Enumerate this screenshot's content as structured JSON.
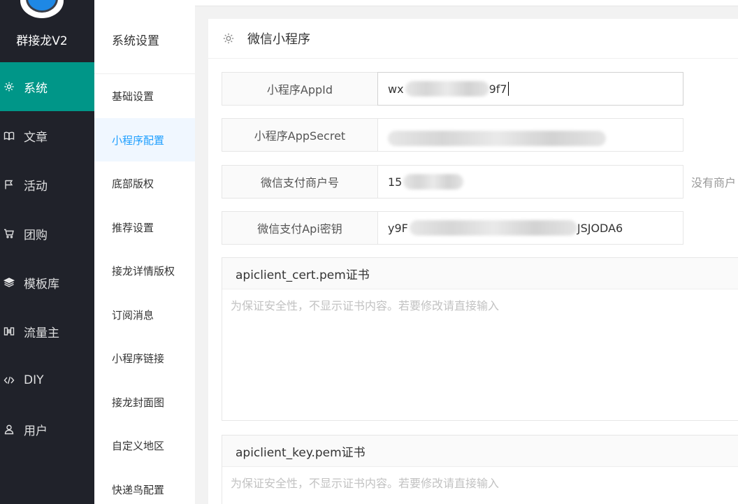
{
  "app": {
    "brand": "群接龙V2"
  },
  "sidebar": {
    "items": [
      {
        "label": "系统",
        "icon": "gear-icon",
        "active": true
      },
      {
        "label": "文章",
        "icon": "book-icon"
      },
      {
        "label": "活动",
        "icon": "flag-icon"
      },
      {
        "label": "团购",
        "icon": "cart-icon"
      },
      {
        "label": "模板库",
        "icon": "layers-icon"
      },
      {
        "label": "流量主",
        "icon": "columns-icon"
      },
      {
        "label": "DIY",
        "icon": "code-icon"
      },
      {
        "label": "用户",
        "icon": "user-icon"
      }
    ]
  },
  "submenu": {
    "title": "系统设置",
    "items": [
      {
        "label": "基础设置"
      },
      {
        "label": "小程序配置",
        "active": true
      },
      {
        "label": "底部版权"
      },
      {
        "label": "推荐设置"
      },
      {
        "label": "接龙详情版权"
      },
      {
        "label": "订阅消息"
      },
      {
        "label": "小程序链接"
      },
      {
        "label": "接龙封面图"
      },
      {
        "label": "自定义地区"
      },
      {
        "label": "快递鸟配置"
      }
    ]
  },
  "main": {
    "title": "微信小程序",
    "fields": [
      {
        "label": "小程序AppId",
        "value_start": "wx",
        "value_end": "9f7"
      },
      {
        "label": "小程序AppSecret",
        "value_start": "",
        "value_end": ""
      },
      {
        "label": "微信支付商户号",
        "value_start": "15",
        "value_end": "",
        "aux": "没有商户"
      },
      {
        "label": "微信支付Api密钥",
        "value_start": "y9F",
        "value_end": "JSJODA6"
      }
    ],
    "certs": [
      {
        "label": "apiclient_cert.pem证书",
        "placeholder": "为保证安全性，不显示证书内容。若要修改请直接输入"
      },
      {
        "label": "apiclient_key.pem证书",
        "placeholder": "为保证安全性，不显示证书内容。若要修改请直接输入"
      }
    ]
  },
  "colors": {
    "sidebar_bg": "#20222a",
    "accent": "#009688",
    "submenu_active": "#1e9fff"
  }
}
